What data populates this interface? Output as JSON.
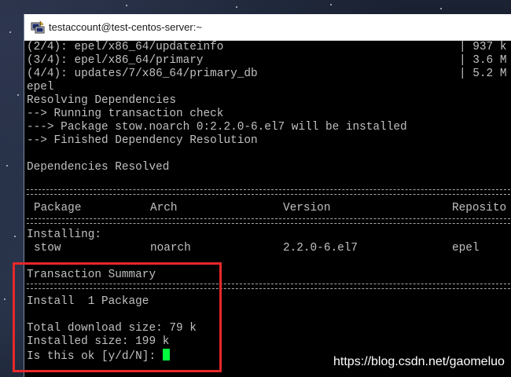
{
  "window": {
    "title": "testaccount@test-centos-server:~",
    "icon": "putty-terminal-icon"
  },
  "terminal": {
    "lines": [
      {
        "text": "(2/4): epel/x86_64/updateinfo",
        "right": "| 937 k"
      },
      {
        "text": "(3/4): epel/x86_64/primary",
        "right": "| 3.6 M"
      },
      {
        "text": "(4/4): updates/7/x86_64/primary_db",
        "right": "| 5.2 M"
      },
      {
        "text": "epel"
      },
      {
        "text": "Resolving Dependencies"
      },
      {
        "text": "--> Running transaction check"
      },
      {
        "text": "---> Package stow.noarch 0:2.2.0-6.el7 will be installed"
      },
      {
        "text": "--> Finished Dependency Resolution"
      },
      {
        "text": "Dependencies Resolved"
      }
    ],
    "table": {
      "headers": [
        "Package",
        "Arch",
        "Version",
        "Reposito"
      ],
      "section": "Installing:",
      "rows": [
        [
          "stow",
          "noarch",
          "2.2.0-6.el7",
          "epel"
        ]
      ]
    },
    "summary": {
      "title": "Transaction Summary",
      "install_line": "Install  1 Package",
      "download_size": "Total download size: 79 k",
      "installed_size": "Installed size: 199 k",
      "prompt": "Is this ok [y/d/N]:"
    },
    "cursor_color": "#00ff3c"
  },
  "annotation": {
    "highlight_color": "#e8282a"
  },
  "watermark": "https://blog.csdn.net/gaomeluo"
}
